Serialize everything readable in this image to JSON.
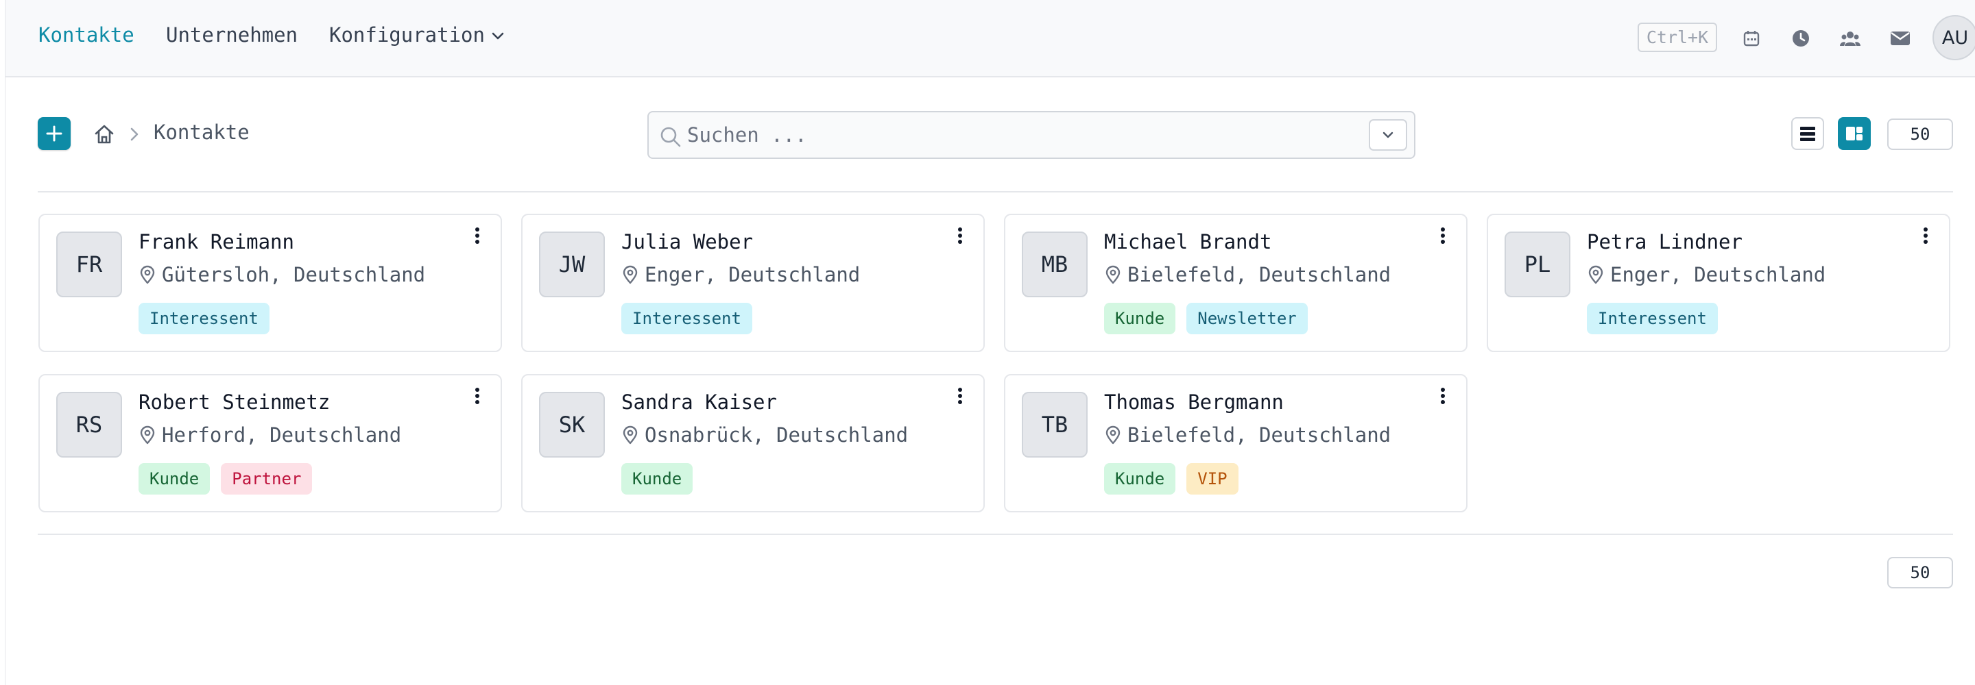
{
  "nav": {
    "contacts": "Kontakte",
    "companies": "Unternehmen",
    "config": "Konfiguration"
  },
  "header": {
    "shortcut": "Ctrl+K",
    "avatar": "AU",
    "icons": [
      "calendar-icon",
      "clock-icon",
      "users-icon",
      "mail-icon"
    ]
  },
  "toolbar": {
    "breadcrumb": "Kontakte",
    "search_placeholder": "Suchen ...",
    "page_size": "50"
  },
  "footer": {
    "page_size": "50"
  },
  "colors": {
    "accent": "#0e8ba6",
    "tag_interessent": "#cff4fb",
    "tag_kunde": "#d3f7e1",
    "tag_partner": "#fde0e6",
    "tag_vip": "#fdecc4"
  },
  "contacts": [
    {
      "initials": "FR",
      "name": "Frank Reimann",
      "location": "Gütersloh, Deutschland",
      "tags": [
        {
          "label": "Interessent",
          "color": "cyan"
        }
      ]
    },
    {
      "initials": "JW",
      "name": "Julia Weber",
      "location": "Enger, Deutschland",
      "tags": [
        {
          "label": "Interessent",
          "color": "cyan"
        }
      ]
    },
    {
      "initials": "MB",
      "name": "Michael Brandt",
      "location": "Bielefeld, Deutschland",
      "tags": [
        {
          "label": "Kunde",
          "color": "green"
        },
        {
          "label": "Newsletter",
          "color": "cyan"
        }
      ]
    },
    {
      "initials": "PL",
      "name": "Petra Lindner",
      "location": "Enger, Deutschland",
      "tags": [
        {
          "label": "Interessent",
          "color": "cyan"
        }
      ]
    },
    {
      "initials": "RS",
      "name": "Robert Steinmetz",
      "location": "Herford, Deutschland",
      "tags": [
        {
          "label": "Kunde",
          "color": "green"
        },
        {
          "label": "Partner",
          "color": "pink"
        }
      ]
    },
    {
      "initials": "SK",
      "name": "Sandra Kaiser",
      "location": "Osnabrück, Deutschland",
      "tags": [
        {
          "label": "Kunde",
          "color": "green"
        }
      ]
    },
    {
      "initials": "TB",
      "name": "Thomas Bergmann",
      "location": "Bielefeld, Deutschland",
      "tags": [
        {
          "label": "Kunde",
          "color": "green"
        },
        {
          "label": "VIP",
          "color": "yellow"
        }
      ]
    }
  ]
}
